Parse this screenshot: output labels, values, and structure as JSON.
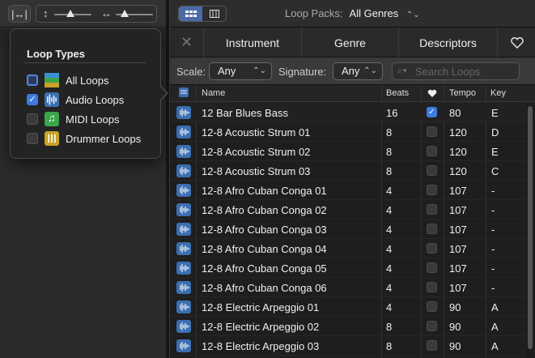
{
  "left_toolbar": {
    "fit_icon": "fit-width-icon",
    "vertical_zoom_icon": "vertical-zoom-icon",
    "horizontal_zoom_icon": "horizontal-zoom-icon"
  },
  "header": {
    "view_buttons": [
      "grid-view-icon",
      "column-view-icon"
    ],
    "loop_packs_label": "Loop Packs:",
    "loop_packs_value": "All Genres"
  },
  "filters": {
    "clear_icon": "close-icon",
    "instrument": "Instrument",
    "genre": "Genre",
    "descriptors": "Descriptors",
    "favorites_icon": "heart-icon"
  },
  "scale": {
    "scale_label": "Scale:",
    "scale_value": "Any",
    "signature_label": "Signature:",
    "signature_value": "Any",
    "search_placeholder": "Search Loops"
  },
  "table": {
    "headers": {
      "name": "Name",
      "beats": "Beats",
      "fav_icon": "heart-icon",
      "tempo": "Tempo",
      "key": "Key"
    },
    "rows": [
      {
        "name": "12 Bar Blues Bass",
        "beats": "16",
        "fav": true,
        "tempo": "80",
        "key": "E"
      },
      {
        "name": "12-8 Acoustic Strum 01",
        "beats": "8",
        "fav": false,
        "tempo": "120",
        "key": "D"
      },
      {
        "name": "12-8 Acoustic Strum 02",
        "beats": "8",
        "fav": false,
        "tempo": "120",
        "key": "E"
      },
      {
        "name": "12-8 Acoustic Strum 03",
        "beats": "8",
        "fav": false,
        "tempo": "120",
        "key": "C"
      },
      {
        "name": "12-8 Afro Cuban Conga 01",
        "beats": "4",
        "fav": false,
        "tempo": "107",
        "key": "-"
      },
      {
        "name": "12-8 Afro Cuban Conga 02",
        "beats": "4",
        "fav": false,
        "tempo": "107",
        "key": "-"
      },
      {
        "name": "12-8 Afro Cuban Conga 03",
        "beats": "4",
        "fav": false,
        "tempo": "107",
        "key": "-"
      },
      {
        "name": "12-8 Afro Cuban Conga 04",
        "beats": "4",
        "fav": false,
        "tempo": "107",
        "key": "-"
      },
      {
        "name": "12-8 Afro Cuban Conga 05",
        "beats": "4",
        "fav": false,
        "tempo": "107",
        "key": "-"
      },
      {
        "name": "12-8 Afro Cuban Conga 06",
        "beats": "4",
        "fav": false,
        "tempo": "107",
        "key": "-"
      },
      {
        "name": "12-8 Electric Arpeggio 01",
        "beats": "4",
        "fav": false,
        "tempo": "90",
        "key": "A"
      },
      {
        "name": "12-8 Electric Arpeggio 02",
        "beats": "8",
        "fav": false,
        "tempo": "90",
        "key": "A"
      },
      {
        "name": "12-8 Electric Arpeggio 03",
        "beats": "8",
        "fav": false,
        "tempo": "90",
        "key": "A"
      }
    ]
  },
  "popover": {
    "title": "Loop Types",
    "items": [
      {
        "label": "All Loops",
        "checked": false,
        "icon": "all-loops-icon",
        "color": "#3a8fd6"
      },
      {
        "label": "Audio Loops",
        "checked": true,
        "icon": "waveform-icon",
        "color": "#3b6fb0"
      },
      {
        "label": "MIDI Loops",
        "checked": false,
        "icon": "music-note-icon",
        "color": "#3aa54a"
      },
      {
        "label": "Drummer Loops",
        "checked": false,
        "icon": "drummer-icon",
        "color": "#c9a227"
      }
    ]
  },
  "colors": {
    "accent": "#3d7be0",
    "audio_loop": "#3b6fb0"
  }
}
